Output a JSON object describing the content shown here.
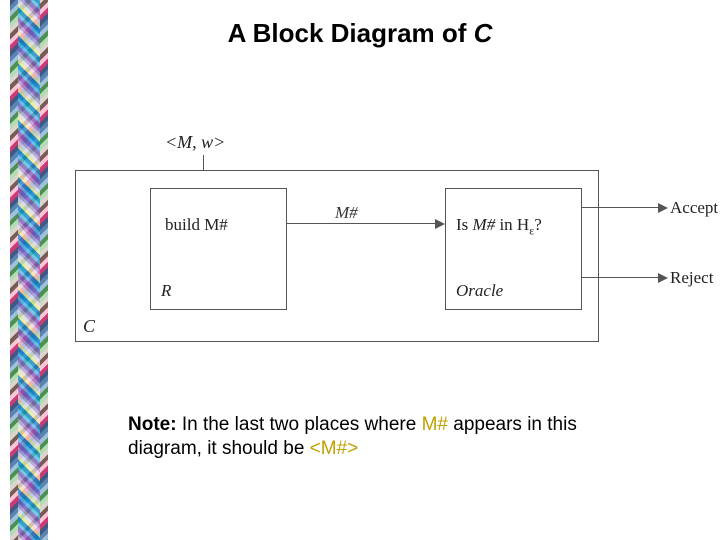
{
  "title_prefix": "A Block Diagram of ",
  "title_C": "C",
  "diagram": {
    "input_label": "<M, w>",
    "box_r": {
      "build": "build M#",
      "r": "R"
    },
    "edge_mhash": "M#",
    "box_o": {
      "is_prefix": "Is ",
      "is_mhash": "M#",
      "is_mid": " in H",
      "is_sub": "ε",
      "is_tail": "?",
      "oracle": "Oracle"
    },
    "accept": "Accept",
    "reject": "Reject",
    "c_label": "C"
  },
  "note": {
    "bold": "Note:",
    "pre": "   In the last two places where ",
    "mh1": "M#",
    "mid": " appears in this diagram, it should be ",
    "mh2": "<M#>"
  }
}
